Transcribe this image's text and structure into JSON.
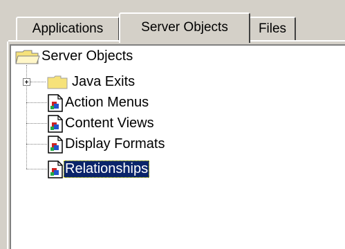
{
  "tabs": [
    {
      "label": "Applications",
      "selected": false
    },
    {
      "label": "Server Objects",
      "selected": true
    },
    {
      "label": "Files",
      "selected": false
    }
  ],
  "tree": {
    "root": {
      "label": "Server Objects",
      "icon": "open-folder-icon"
    },
    "children": [
      {
        "label": "Java Exits",
        "icon": "folder-icon",
        "expandable": true
      },
      {
        "label": "Action Menus",
        "icon": "server-object-document-icon"
      },
      {
        "label": "Content Views",
        "icon": "server-object-document-icon"
      },
      {
        "label": "Display Formats",
        "icon": "server-object-document-icon"
      },
      {
        "label": "Relationships",
        "icon": "server-object-document-icon",
        "selected": true
      }
    ]
  },
  "colors": {
    "window_background": "#d4d0c8",
    "tree_background": "#ffffff",
    "selection_background": "#0a246a",
    "selection_text": "#ffffff",
    "folder_yellow": "#f6e27a"
  }
}
